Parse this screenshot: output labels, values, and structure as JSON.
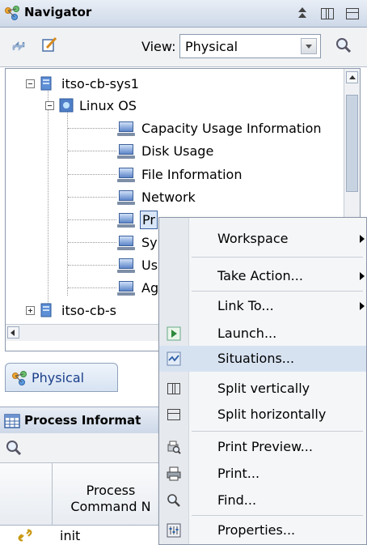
{
  "navigator": {
    "title": "Navigator",
    "view_label": "View:",
    "view_value": "Physical",
    "tab_label": "Physical"
  },
  "tree": {
    "items": [
      {
        "label": "itso-cb-sys1"
      },
      {
        "label": "Linux OS"
      },
      {
        "label": "Capacity Usage Information"
      },
      {
        "label": "Disk Usage"
      },
      {
        "label": "File Information"
      },
      {
        "label": "Network"
      },
      {
        "label": "Pr"
      },
      {
        "label": "Sy"
      },
      {
        "label": "Us"
      },
      {
        "label": "Ag"
      },
      {
        "label": "itso-cb-s"
      }
    ]
  },
  "process_panel": {
    "title": "Process Informat",
    "column_header_line1": "Process",
    "column_header_line2": "Command N",
    "rows": [
      {
        "command": "init"
      }
    ]
  },
  "context_menu": {
    "items": [
      {
        "label": "Workspace",
        "icon": "none",
        "submenu": true
      },
      {
        "label": "Take Action...",
        "icon": "none",
        "submenu": true
      },
      {
        "label": "Link To...",
        "icon": "none",
        "submenu": true
      },
      {
        "label": "Launch...",
        "icon": "launch-icon",
        "submenu": false
      },
      {
        "label": "Situations...",
        "icon": "situations-icon",
        "submenu": false,
        "highlighted": true
      },
      {
        "label": "Split vertically",
        "icon": "split-vertical-icon",
        "submenu": false
      },
      {
        "label": "Split horizontally",
        "icon": "split-horizontal-icon",
        "submenu": false
      },
      {
        "label": "Print Preview...",
        "icon": "print-preview-icon",
        "submenu": false
      },
      {
        "label": "Print...",
        "icon": "printer-icon",
        "submenu": false
      },
      {
        "label": "Find...",
        "icon": "magnifier-icon",
        "submenu": false
      },
      {
        "label": "Properties...",
        "icon": "properties-icon",
        "submenu": false
      }
    ]
  },
  "colors": {
    "title_bar": "#cdd8e8",
    "menu_highlight": "#d7e2f1",
    "tab_text": "#1b3f8a"
  }
}
